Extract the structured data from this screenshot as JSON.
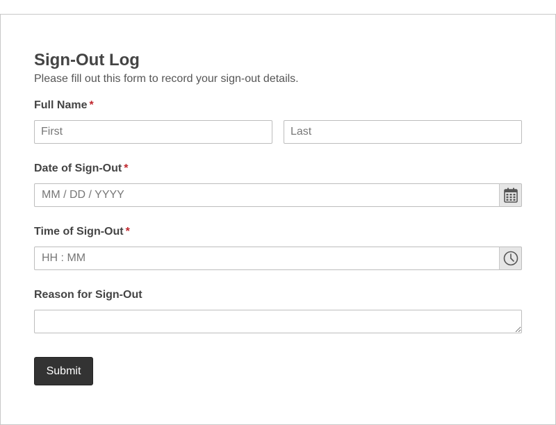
{
  "form": {
    "title": "Sign-Out Log",
    "subtitle": "Please fill out this form to record your sign-out details.",
    "required_marker": "*",
    "full_name": {
      "label": "Full Name",
      "first_placeholder": "First",
      "last_placeholder": "Last",
      "first_value": "",
      "last_value": ""
    },
    "date": {
      "label": "Date of Sign-Out",
      "placeholder": "MM / DD / YYYY",
      "value": "",
      "icon": "calendar-icon"
    },
    "time": {
      "label": "Time of Sign-Out",
      "placeholder": "HH : MM",
      "value": "",
      "icon": "clock-icon"
    },
    "reason": {
      "label": "Reason for Sign-Out",
      "value": ""
    },
    "submit_label": "Submit"
  },
  "colors": {
    "required": "#c0262d",
    "submit_bg": "#333333",
    "addon_bg": "#e6e6e6",
    "border": "#bdbdbd"
  }
}
